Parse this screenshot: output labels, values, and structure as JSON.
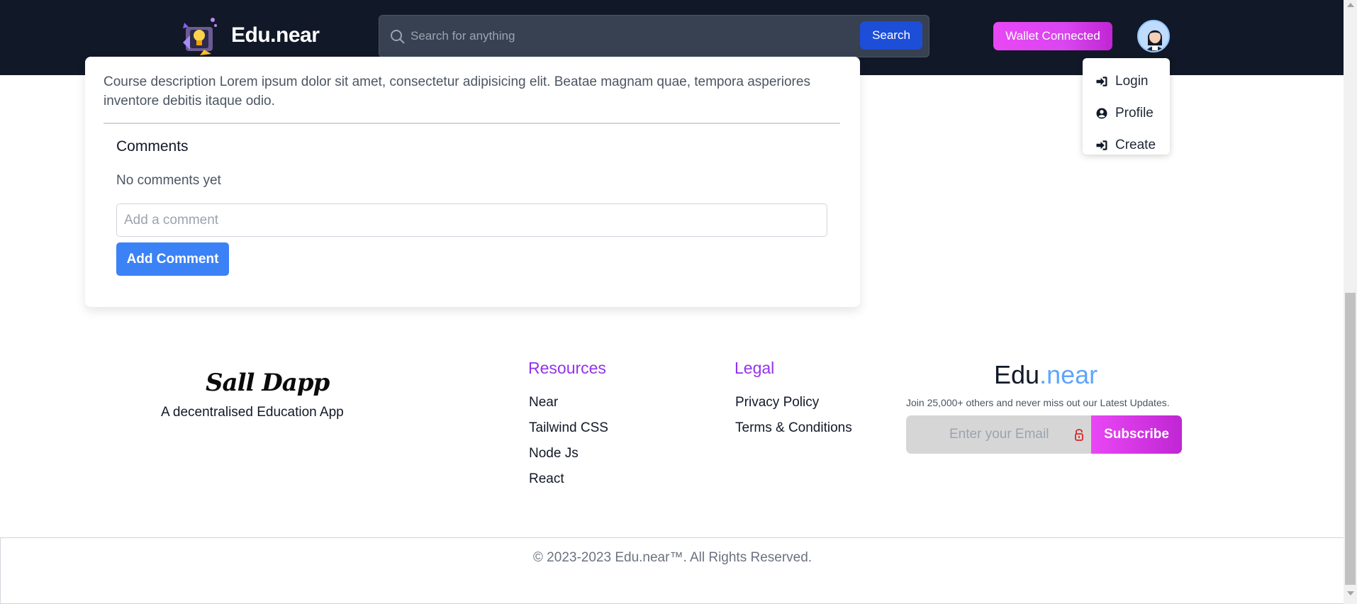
{
  "header": {
    "brand": "Edu.near",
    "search_placeholder": "Search for anything",
    "search_button": "Search",
    "wallet_button": "Wallet Connected"
  },
  "dropdown": {
    "items": [
      {
        "label": "Login",
        "icon": "sign-in-icon"
      },
      {
        "label": "Profile",
        "icon": "user-circle-icon"
      },
      {
        "label": "Create",
        "icon": "sign-in-icon"
      }
    ]
  },
  "course": {
    "description": "Course description Lorem ipsum dolor sit amet, consectetur adipisicing elit. Beatae magnam quae, tempora asperiores inventore debitis itaque odio.",
    "comments_title": "Comments",
    "no_comments": "No comments yet",
    "comment_placeholder": "Add a comment",
    "add_comment_button": "Add Comment"
  },
  "footer": {
    "logo": "Sall Dapp",
    "tagline": "A decentralised Education App",
    "resources": {
      "title": "Resources",
      "links": [
        "Near",
        "Tailwind CSS",
        "Node Js",
        "React"
      ]
    },
    "legal": {
      "title": "Legal",
      "links": [
        "Privacy Policy",
        "Terms & Conditions"
      ]
    },
    "newsletter": {
      "brand_main": "Edu",
      "brand_accent": ".near",
      "text": "Join 25,000+ others and never miss out our Latest Updates.",
      "email_placeholder": "Enter your Email",
      "subscribe_button": "Subscribe"
    },
    "copyright": "© 2023-2023 Edu.near™. All Rights Reserved."
  },
  "colors": {
    "header_bg": "#111827",
    "primary_blue": "#3b82f6",
    "accent_purple": "#9333ea",
    "wallet_gradient": "#e947f5"
  }
}
